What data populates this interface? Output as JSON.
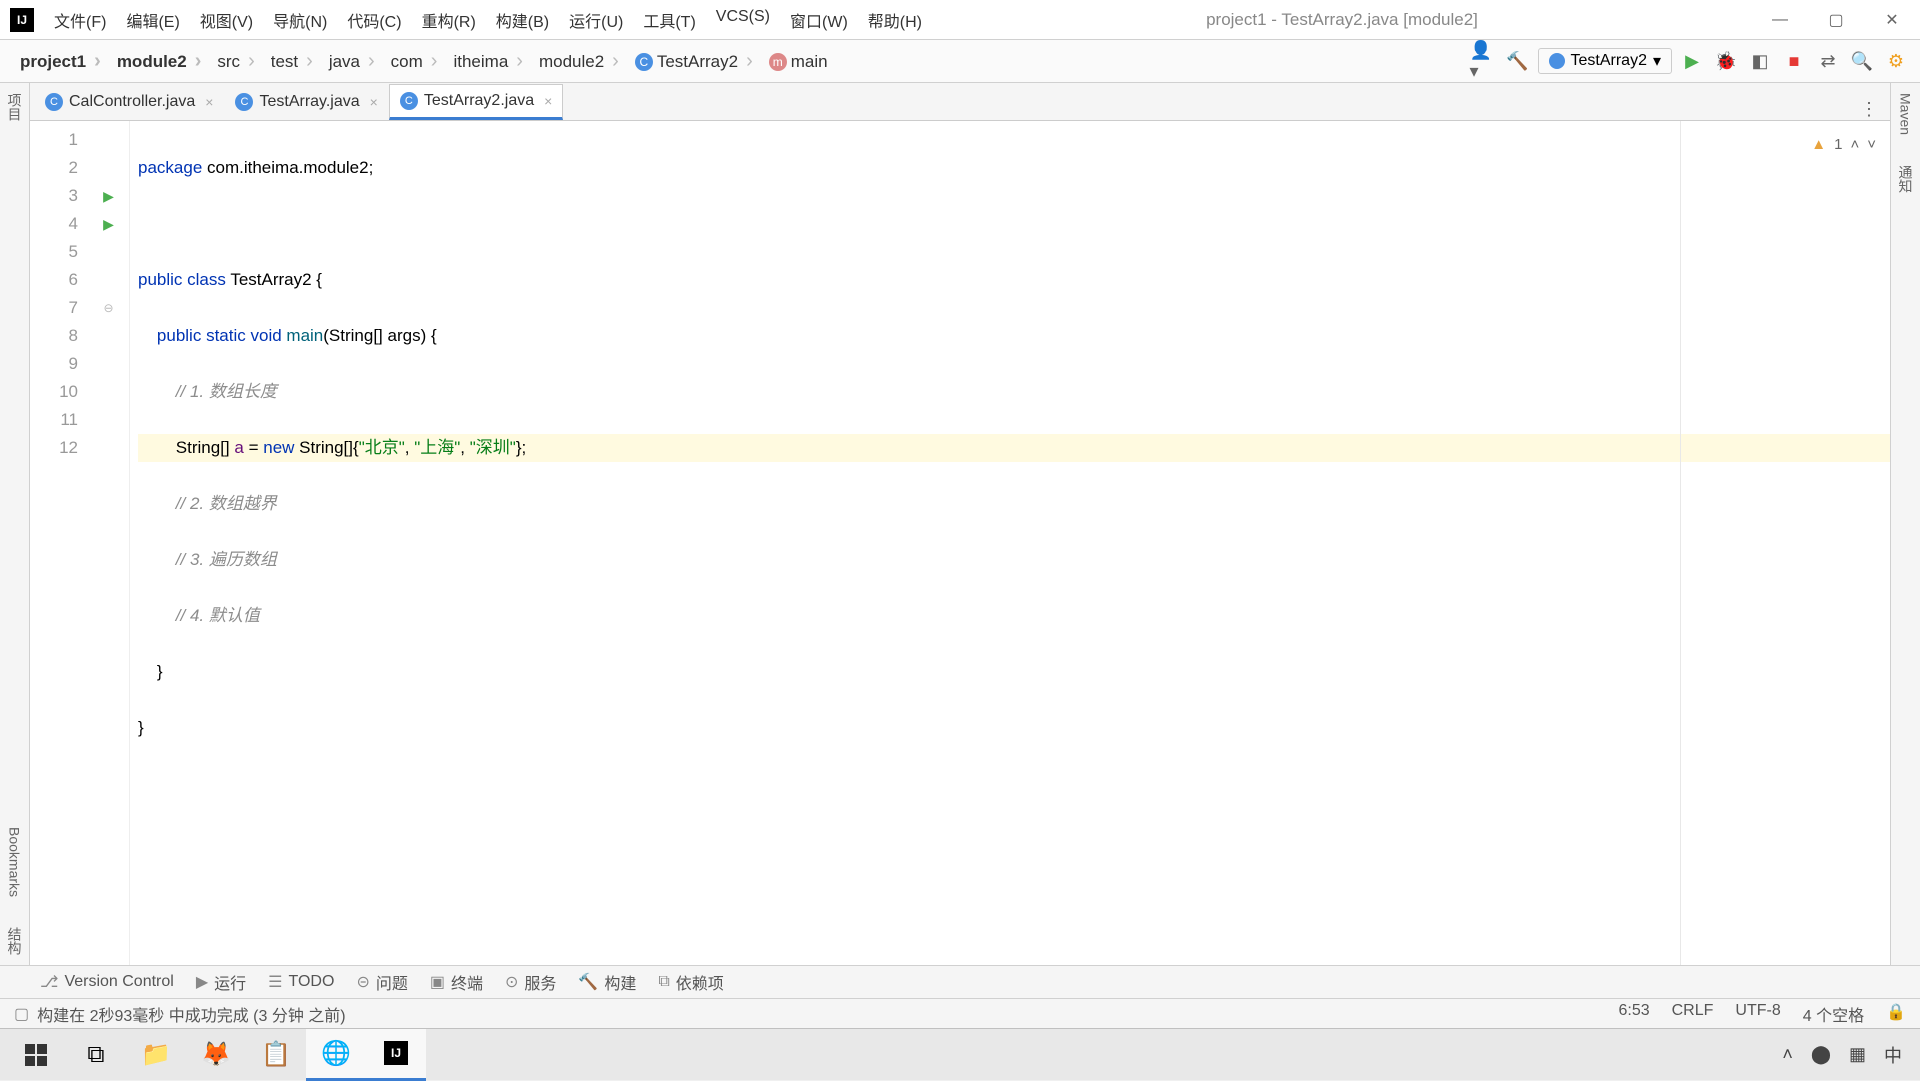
{
  "window": {
    "title": "project1 - TestArray2.java [module2]"
  },
  "menu": [
    "文件(F)",
    "编辑(E)",
    "视图(V)",
    "导航(N)",
    "代码(C)",
    "重构(R)",
    "构建(B)",
    "运行(U)",
    "工具(T)",
    "VCS(S)",
    "窗口(W)",
    "帮助(H)"
  ],
  "breadcrumb": [
    "project1",
    "module2",
    "src",
    "test",
    "java",
    "com",
    "itheima",
    "module2"
  ],
  "breadcrumb_class": "TestArray2",
  "breadcrumb_method": "main",
  "run_config": "TestArray2",
  "tabs": [
    {
      "name": "CalController.java",
      "active": false
    },
    {
      "name": "TestArray.java",
      "active": false
    },
    {
      "name": "TestArray2.java",
      "active": true
    }
  ],
  "code": {
    "lines": [
      1,
      2,
      3,
      4,
      5,
      6,
      7,
      8,
      9,
      10,
      11,
      12
    ],
    "l1": {
      "kw": "package",
      "rest": " com.itheima.module2;"
    },
    "l3": {
      "kw1": "public",
      "kw2": "class",
      "cls": "TestArray2",
      "br": " {"
    },
    "l4": {
      "kw1": "public",
      "kw2": "static",
      "kw3": "void",
      "mth": "main",
      "args": "(String[] args) {"
    },
    "l5": "// 1. 数组长度",
    "l6": {
      "pre": "String[] ",
      "var": "a",
      "mid": " = ",
      "kw": "new",
      "post": " String[]{",
      "s1": "\"北京\"",
      "c1": ", ",
      "s2": "\"上海\"",
      "c2": ", ",
      "s3": "\"深圳\"",
      "end": "};"
    },
    "l7": "// 2. 数组越界",
    "l8": "// 3. 遍历数组",
    "l9": "// 4. 默认值",
    "l10": "}",
    "l11": "}"
  },
  "inspection": {
    "warnings": "1"
  },
  "bottom_tabs": [
    "Version Control",
    "运行",
    "TODO",
    "问题",
    "终端",
    "服务",
    "构建",
    "依赖项"
  ],
  "bottom_icons": [
    "⎇",
    "▶",
    "☰",
    "⊝",
    "▣",
    "⊙",
    "🔨",
    "⧉"
  ],
  "status": {
    "build": "构建在 2秒93毫秒 中成功完成 (3 分钟 之前)",
    "pos": "6:53",
    "sep": "CRLF",
    "enc": "UTF-8",
    "indent": "4 个空格"
  },
  "left_tools": [
    "项目",
    "Bookmarks",
    "结构"
  ],
  "right_tools": [
    "Maven",
    "通知"
  ],
  "tray": {
    "ime": "中"
  }
}
